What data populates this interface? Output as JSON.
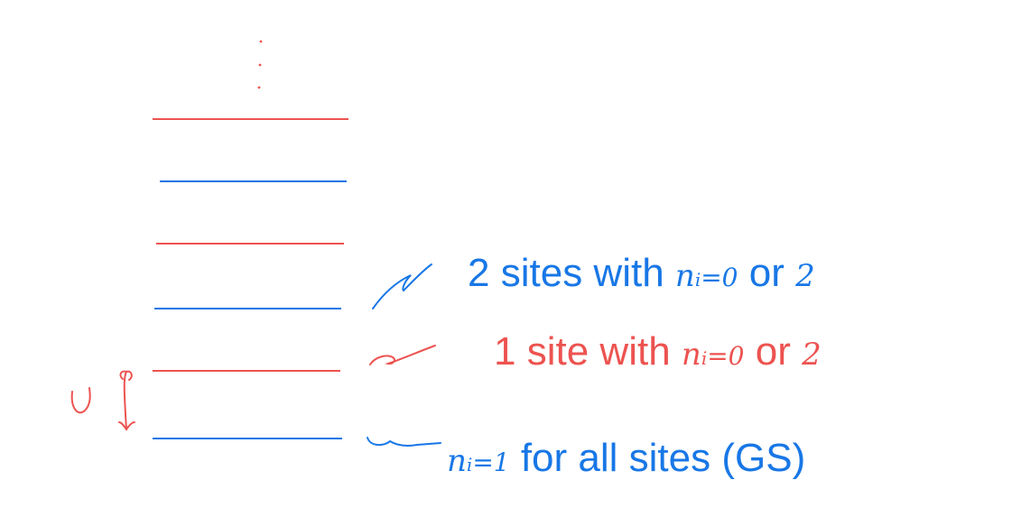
{
  "colors": {
    "blue": "#1877e6",
    "red": "#ec5350"
  },
  "labels": {
    "two_sites": {
      "count": "2",
      "text_a": "sites with",
      "n": "n",
      "sub": "i",
      "eq": "=0",
      "or": "or",
      "val": "2"
    },
    "one_site": {
      "count": "1",
      "text_a": "site with",
      "n": "n",
      "sub": "i",
      "eq": "=0",
      "or": "or",
      "val": "2"
    },
    "ground": {
      "n": "n",
      "sub": "i",
      "eq": "=1",
      "text_a": "for all sites (GS)"
    },
    "gap": "U"
  }
}
